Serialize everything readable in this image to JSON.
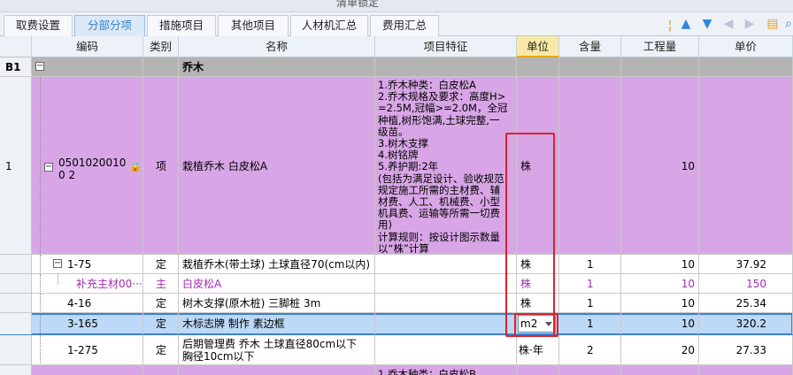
{
  "window": {
    "title": "清单锁定"
  },
  "tabs": [
    "取费设置",
    "分部分项",
    "措施项目",
    "其他项目",
    "人材机汇总",
    "费用汇总"
  ],
  "active_tab": "分部分项",
  "toolbar_icons": [
    "move-up-icon",
    "move-down-icon",
    "move-left-icon",
    "move-right-icon",
    "search-icon",
    "settings-icon"
  ],
  "columns": [
    "编码",
    "类别",
    "名称",
    "项目特征",
    "单位",
    "含量",
    "工程量",
    "单价"
  ],
  "rows": [
    {
      "num": "B1",
      "code": "",
      "type": "",
      "name": "乔木",
      "feature": "",
      "unit": "",
      "content": "",
      "qty": "",
      "price": ""
    },
    {
      "num": "1",
      "code": "05010200100 2",
      "type": "项",
      "name": "栽植乔木 白皮松A",
      "feature": "1.乔木种类：白皮松A\n2.乔木规格及要求：高度H>=2.5M,冠幅>=2.0M，全冠种植,树形饱满,土球完整,一级苗。\n3.树木支撑\n4.树铭牌\n5.养护期:2年\n(包括为满足设计、验收规范规定施工所需的主材费、辅材费、人工、机械费、小型机具费、运输等所需一切费用)\n计算规则：按设计图示数量以“株”计算",
      "unit": "株",
      "content": "",
      "qty": "10",
      "price": ""
    },
    {
      "num": "",
      "code": "1-75",
      "type": "定",
      "name": "栽植乔木(带土球) 土球直径70(cm以内)",
      "feature": "",
      "unit": "株",
      "content": "1",
      "qty": "10",
      "price": "37.92"
    },
    {
      "num": "",
      "code": "补充主材00···",
      "type": "主",
      "name": "白皮松A",
      "feature": "",
      "unit": "株",
      "content": "1",
      "qty": "10",
      "price": "150"
    },
    {
      "num": "",
      "code": "4-16",
      "type": "定",
      "name": "树木支撑(原木桩) 三脚桩 3m",
      "feature": "",
      "unit": "株",
      "content": "1",
      "qty": "10",
      "price": "25.34"
    },
    {
      "num": "",
      "code": "3-165",
      "type": "定",
      "name": "木标志牌 制作 素边框",
      "feature": "",
      "unit": "m2",
      "content": "1",
      "qty": "10",
      "price": "320.2"
    },
    {
      "num": "",
      "code": "1-275",
      "type": "定",
      "name": "后期管理费 乔木 土球直径80cm以下 胸径10cm以下",
      "feature": "",
      "unit": "株·年",
      "content": "2",
      "qty": "20",
      "price": "27.33"
    },
    {
      "num": "",
      "code": "",
      "type": "",
      "name": "",
      "feature": "1.乔木种类：白皮松B",
      "unit": "",
      "content": "",
      "qty": "",
      "price": ""
    }
  ]
}
